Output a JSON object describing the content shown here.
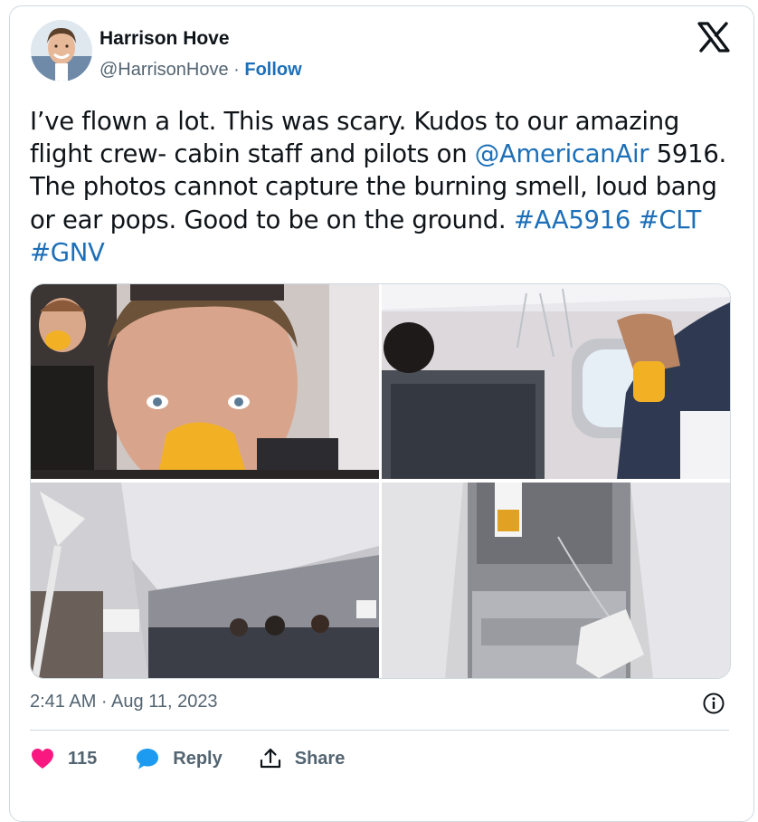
{
  "author": {
    "name": "Harrison Hove",
    "handle": "@HarrisonHove",
    "separator": "·",
    "follow_label": "Follow"
  },
  "tweet": {
    "text_parts": {
      "p1": "I’ve flown a lot. This was scary. Kudos to our amazing flight crew- cabin staff and pilots on ",
      "mention": "@AmericanAir",
      "p2": " 5916. The photos cannot capture the burning smell, loud bang or ear pops. Good to be on the ground. ",
      "hashtag1": "#AA5916",
      "hashtag2": "#CLT",
      "hashtag3": "#GNV"
    },
    "timestamp": "2:41 AM · Aug 11, 2023"
  },
  "media": {
    "photo_count": 4
  },
  "actions": {
    "likes": "115",
    "reply_label": "Reply",
    "share_label": "Share"
  },
  "colors": {
    "link": "#1d6fb8",
    "like": "#f91880",
    "reply": "#1d9bf0",
    "muted": "#536471",
    "border": "#cfd9de"
  },
  "icons": [
    "avatar",
    "x-logo-icon",
    "info-icon",
    "heart-icon",
    "reply-bubble-icon",
    "share-icon"
  ]
}
